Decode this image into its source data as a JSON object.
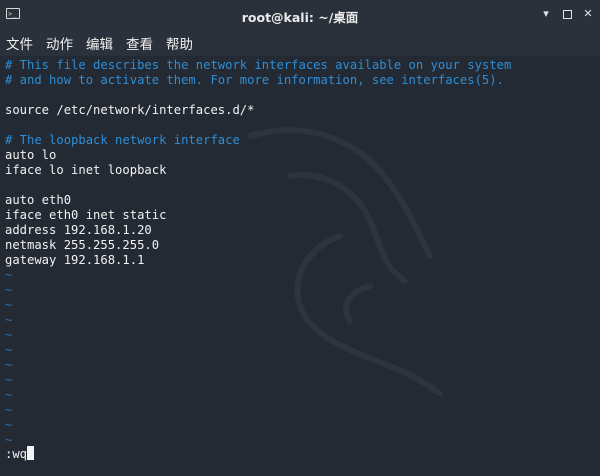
{
  "window": {
    "title": "root@kali: ~/桌面",
    "terminal_icon": "terminal-icon",
    "buttons": [
      "minimize-icon",
      "maximize-icon",
      "close-icon"
    ]
  },
  "menu": {
    "items": [
      "文件",
      "动作",
      "编辑",
      "查看",
      "帮助"
    ]
  },
  "editor": {
    "lines": [
      {
        "text": "# This file describes the network interfaces available on your system",
        "type": "comment"
      },
      {
        "text": "# and how to activate them. For more information, see interfaces(5).",
        "type": "comment"
      },
      {
        "text": "",
        "type": "text"
      },
      {
        "text": "source /etc/network/interfaces.d/*",
        "type": "text"
      },
      {
        "text": "",
        "type": "text"
      },
      {
        "text": "# The loopback network interface",
        "type": "comment"
      },
      {
        "text": "auto lo",
        "type": "text"
      },
      {
        "text": "iface lo inet loopback",
        "type": "text"
      },
      {
        "text": "",
        "type": "text"
      },
      {
        "text": "auto eth0",
        "type": "text"
      },
      {
        "text": "iface eth0 inet static",
        "type": "text"
      },
      {
        "text": "address 192.168.1.20",
        "type": "text"
      },
      {
        "text": "netmask 255.255.255.0",
        "type": "text"
      },
      {
        "text": "gateway 192.168.1.1",
        "type": "text"
      },
      {
        "text": "~",
        "type": "tilde"
      },
      {
        "text": "~",
        "type": "tilde"
      },
      {
        "text": "~",
        "type": "tilde"
      },
      {
        "text": "~",
        "type": "tilde"
      },
      {
        "text": "~",
        "type": "tilde"
      },
      {
        "text": "~",
        "type": "tilde"
      },
      {
        "text": "~",
        "type": "tilde"
      },
      {
        "text": "~",
        "type": "tilde"
      },
      {
        "text": "~",
        "type": "tilde"
      },
      {
        "text": "~",
        "type": "tilde"
      },
      {
        "text": "~",
        "type": "tilde"
      },
      {
        "text": "~",
        "type": "tilde"
      }
    ],
    "command": ":wq"
  },
  "colors": {
    "background": "#232a33",
    "titlebar": "#2b313b",
    "comment": "#2f8dd6",
    "tilde": "#2f6fb0",
    "text": "#f2f2f2"
  }
}
